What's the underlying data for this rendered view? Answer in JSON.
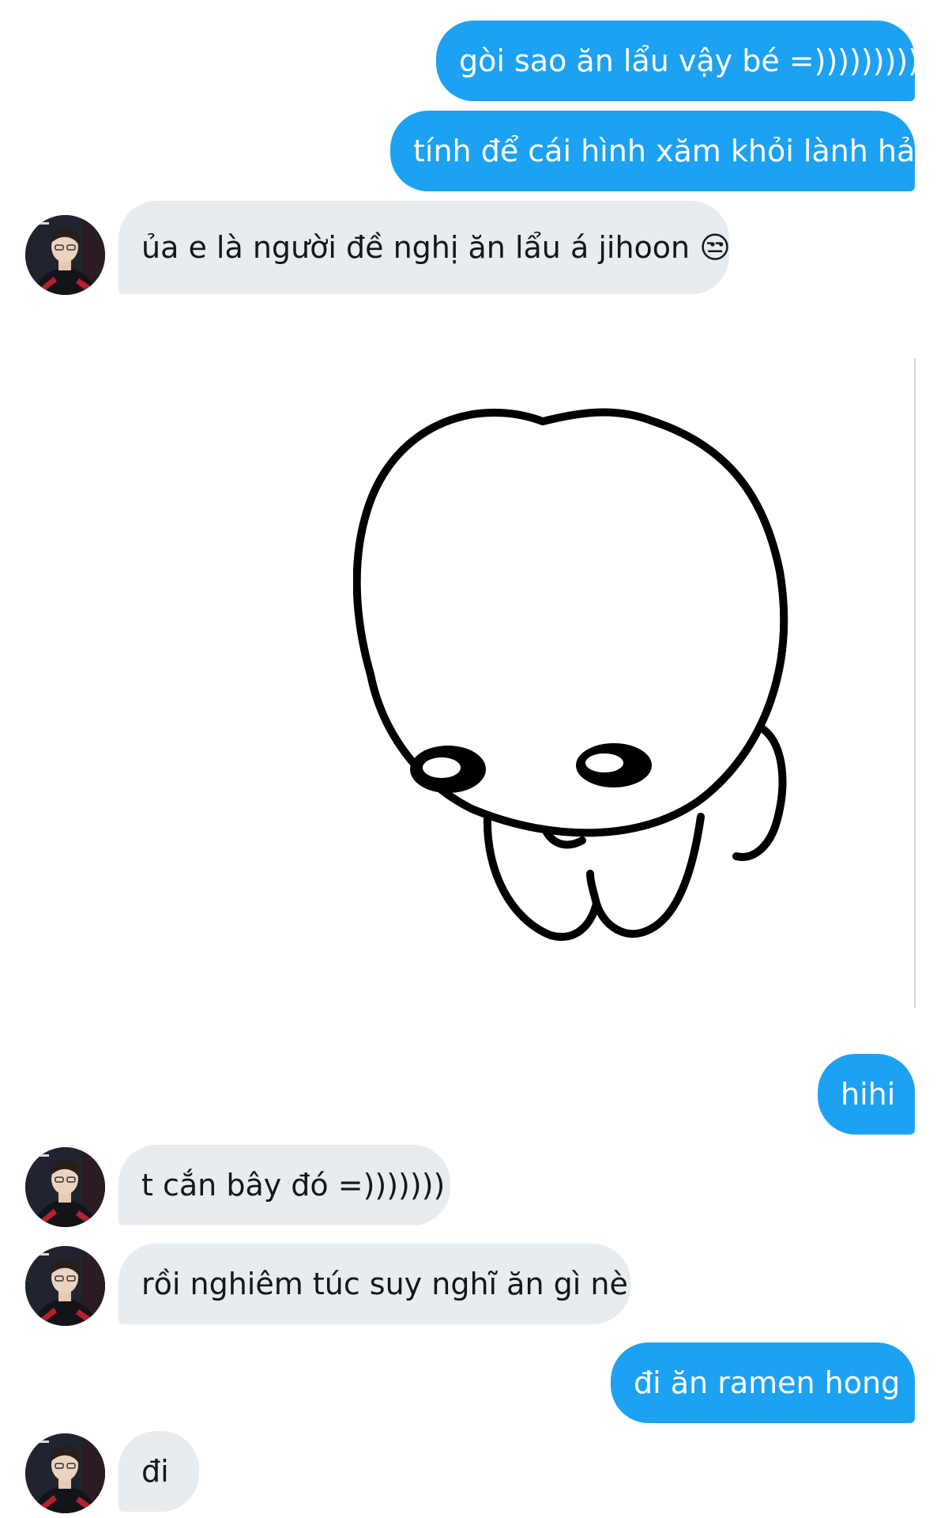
{
  "messages": [
    {
      "side": "out",
      "text": "gòi sao ăn lẩu vậy bé =)))))))))"
    },
    {
      "side": "out",
      "text": "tính để cái hình xăm khỏi lành hả"
    },
    {
      "side": "in",
      "text": "ủa e là người đề nghị ăn lẩu á jihoon 😒"
    },
    {
      "side": "in",
      "type": "sticker",
      "description_icon": "bowing-blob-sticker"
    },
    {
      "side": "out",
      "text": "hihi"
    },
    {
      "side": "in",
      "text": "t cắn bây đó =)))))))"
    },
    {
      "side": "in",
      "text": "rồi nghiêm túc suy nghĩ ăn gì nè"
    },
    {
      "side": "out",
      "text": "đi ăn ramen hong"
    },
    {
      "side": "in",
      "text": "đi"
    }
  ],
  "colors": {
    "outgoing_bubble": "#1da1f2",
    "incoming_bubble": "#e6ecf0",
    "outgoing_text": "#ffffff",
    "incoming_text": "#14171a"
  },
  "icons": {
    "avatar": "contact-avatar-icon",
    "sticker": "bowing-blob-sticker"
  }
}
